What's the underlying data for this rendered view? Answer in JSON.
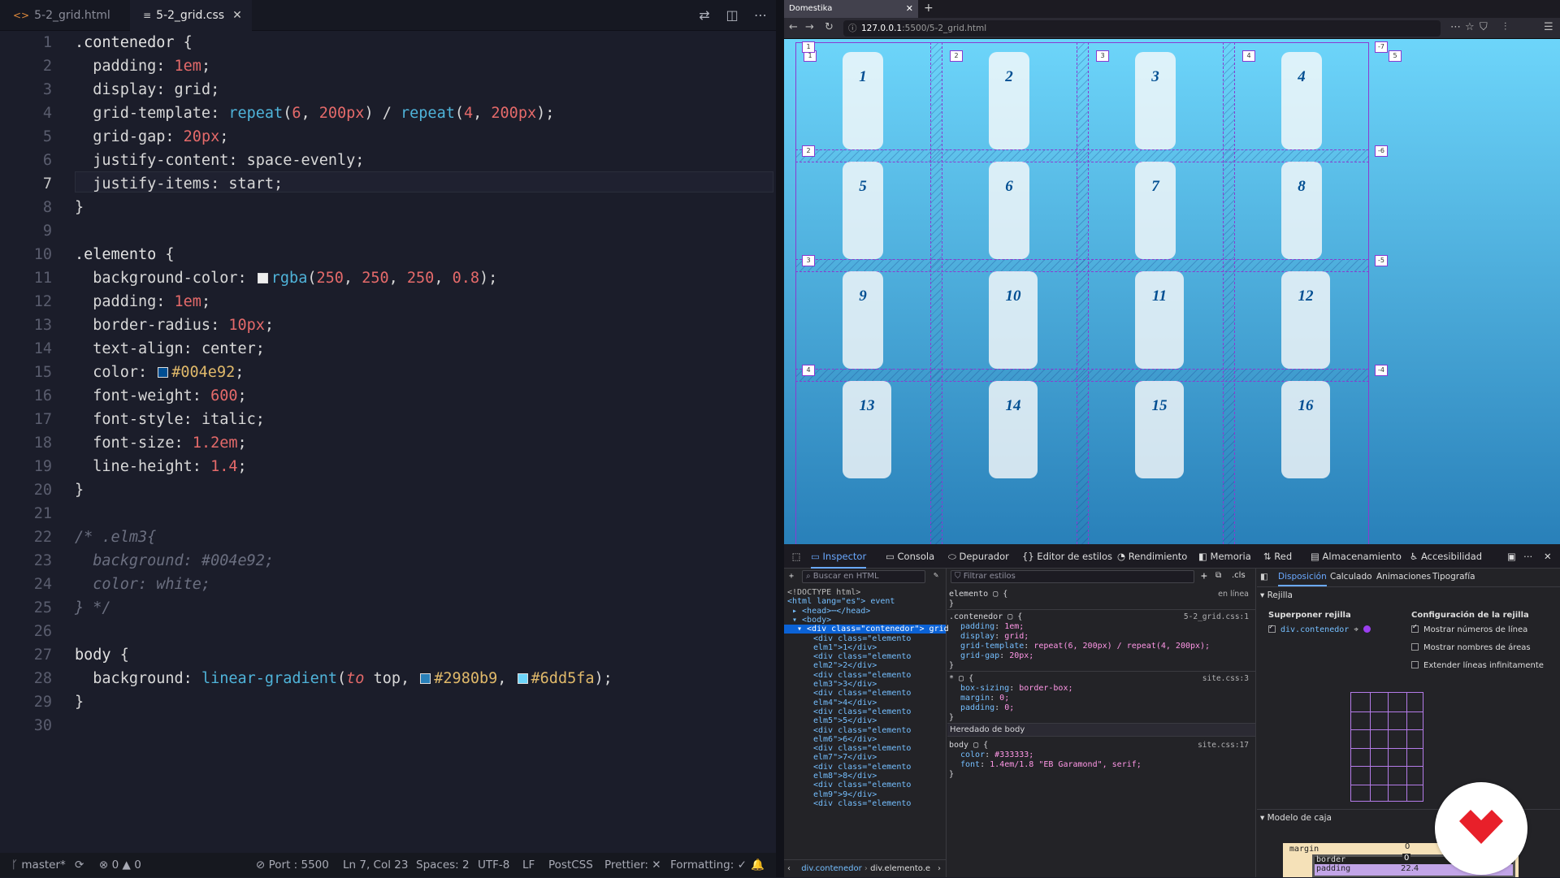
{
  "editor": {
    "tabs": [
      {
        "label": "5-2_grid.html",
        "icon": "html-file-icon"
      },
      {
        "label": "5-2_grid.css",
        "icon": "css-file-icon",
        "active": true
      }
    ],
    "current_line": 7,
    "lines": [
      ".contenedor {",
      "  padding: 1em;",
      "  display: grid;",
      "  grid-template: repeat(6, 200px) / repeat(4, 200px);",
      "  grid-gap: 20px;",
      "  justify-content: space-evenly;",
      "  justify-items: start;",
      "}",
      "",
      ".elemento {",
      "  background-color: rgba(250, 250, 250, 0.8);",
      "  padding: 1em;",
      "  border-radius: 10px;",
      "  text-align: center;",
      "  color: #004e92;",
      "  font-weight: 600;",
      "  font-style: italic;",
      "  font-size: 1.2em;",
      "  line-height: 1.4;",
      "}",
      "",
      "/* .elm3{",
      "  background: #004e92;",
      "  color: white;",
      "} */",
      "",
      "body {",
      "  background: linear-gradient(to top, #2980b9, #6dd5fa);",
      "}",
      ""
    ],
    "status": {
      "branch": "master*",
      "errors": "0",
      "warnings": "0",
      "port": "Port : 5500",
      "position": "Ln 7, Col 23",
      "spaces": "Spaces: 2",
      "encoding": "UTF-8",
      "eol": "LF",
      "language": "PostCSS",
      "prettier": "Prettier: ✕",
      "formatting": "Formatting: ✓"
    }
  },
  "browser": {
    "tab_title": "Domestika",
    "url_host": "127.0.0.1",
    "url_rest": ":5500/5-2_grid.html",
    "grid_items": [
      "1",
      "2",
      "3",
      "4",
      "5",
      "6",
      "7",
      "8",
      "9",
      "10",
      "11",
      "12",
      "13",
      "14",
      "15",
      "16"
    ],
    "col_badges": [
      "1",
      "2",
      "3",
      "4",
      "5"
    ],
    "row_badges_left": [
      "1",
      "2",
      "3",
      "4"
    ],
    "row_badges_right": [
      "-7",
      "-6",
      "-5",
      "-4"
    ],
    "colors": {
      "gradient_bottom": "#2980b9",
      "gradient_top": "#6dd5fa",
      "item_text": "#004e92",
      "grid_overlay": "#8a3bd1"
    }
  },
  "devtools": {
    "tabs": [
      "Inspector",
      "Consola",
      "Depurador",
      "Editor de estilos",
      "Rendimiento",
      "Memoria",
      "Red",
      "Almacenamiento",
      "Accesibilidad"
    ],
    "search_placeholder": "Buscar en HTML",
    "filter_placeholder": "Filtrar estilos",
    "cls_label": ".cls",
    "html_lines": [
      "<!DOCTYPE html>",
      "<html lang=\"es\"> event",
      "▸ <head>⋯</head>",
      "▾ <body>",
      "▾ <div class=\"contenedor\"> grid",
      "<div class=\"elemento",
      "elm1\">1</div>",
      "<div class=\"elemento",
      "elm2\">2</div>",
      "<div class=\"elemento",
      "elm3\">3</div>",
      "<div class=\"elemento",
      "elm4\">4</div>",
      "<div class=\"elemento",
      "elm5\">5</div>",
      "<div class=\"elemento",
      "elm6\">6</div>",
      "<div class=\"elemento",
      "elm7\">7</div>",
      "<div class=\"elemento",
      "elm8\">8</div>",
      "<div class=\"elemento",
      "elm9\">9</div>",
      "<div class=\"elemento"
    ],
    "breadcrumb": [
      "div.contenedor",
      "div.elemento.e"
    ],
    "styles": {
      "inline_rule": "elemento",
      "inline_source": "en línea",
      "contenedor_selector": ".contenedor",
      "contenedor_source": "5-2_grid.css:1",
      "contenedor_decls": [
        {
          "prop": "padding",
          "val": "1em;"
        },
        {
          "prop": "display",
          "val": "grid;"
        },
        {
          "prop": "grid-template",
          "val": "repeat(6, 200px) / repeat(4, 200px);"
        },
        {
          "prop": "grid-gap",
          "val": "20px;"
        }
      ],
      "universal_selector": "*",
      "universal_source": "site.css:3",
      "universal_decls": [
        {
          "prop": "box-sizing",
          "val": "border-box;"
        },
        {
          "prop": "margin",
          "val": "0;"
        },
        {
          "prop": "padding",
          "val": "0;"
        }
      ],
      "inherited_label": "Heredado de body",
      "body_selector": "body",
      "body_source": "site.css:17",
      "body_decls": [
        {
          "prop": "color",
          "val": "#333333;"
        },
        {
          "prop": "font",
          "val": "1.4em/1.8 \"EB Garamond\", serif;"
        }
      ]
    },
    "layout": {
      "tabs": [
        "Disposición",
        "Calculado",
        "Animaciones",
        "Tipografía"
      ],
      "grid_section": "Rejilla",
      "overlay_title": "Superponer rejilla",
      "overlay_item": "div.contenedor",
      "config_title": "Configuración de la rejilla",
      "options": [
        {
          "label": "Mostrar números de línea",
          "checked": true
        },
        {
          "label": "Mostrar nombres de áreas",
          "checked": false
        },
        {
          "label": "Extender líneas infinitamente",
          "checked": false
        }
      ],
      "boxmodel_section": "Modelo de caja",
      "margin_label": "margin",
      "margin_value": "0",
      "border_label": "border",
      "border_value": "0",
      "padding_label": "padding",
      "padding_value": "22.4"
    }
  }
}
